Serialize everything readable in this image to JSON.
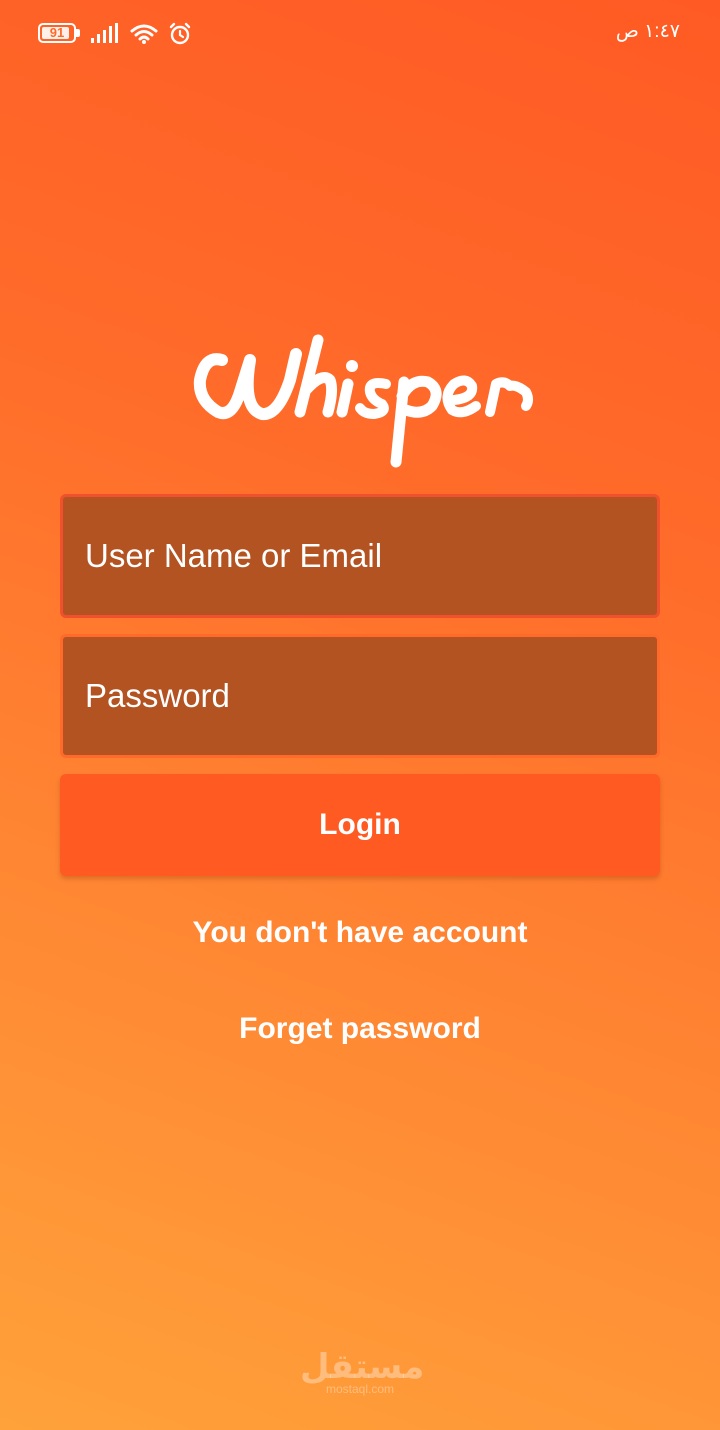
{
  "status_bar": {
    "battery_level": "91",
    "battery_fraction": 0.91,
    "time": "١:٤٧ ص",
    "icons": [
      "battery-icon",
      "signal-icon",
      "wifi-icon",
      "alarm-icon"
    ]
  },
  "app": {
    "logo_text": "Whisper"
  },
  "login_form": {
    "username_placeholder": "User Name or Email",
    "username_value": "",
    "password_placeholder": "Password",
    "password_value": "",
    "login_label": "Login",
    "signup_link": "You don't have account",
    "forget_link": "Forget password"
  },
  "watermark": {
    "arabic": "مستقل",
    "latin": "mostaql.com"
  },
  "colors": {
    "gradient_top": "#ff5a24",
    "gradient_bottom": "#ffa23a",
    "field_fill": "#b35322",
    "field_border": "#f0502c",
    "button": "#ff5a22",
    "text": "#ffffff"
  }
}
